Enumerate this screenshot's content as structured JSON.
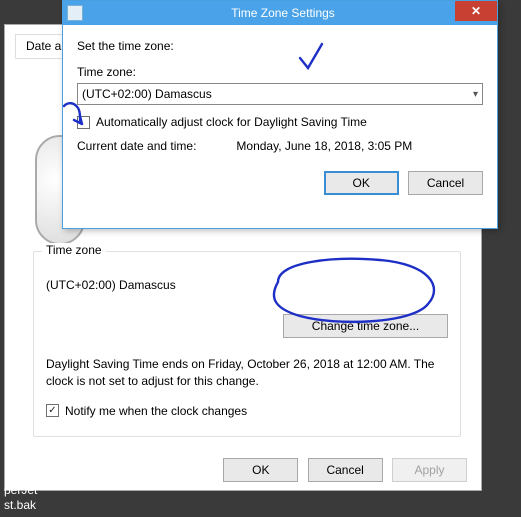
{
  "background": {
    "tab_label": "Date a",
    "fieldset": {
      "legend": "Time zone",
      "value": "(UTC+02:00) Damascus",
      "change_button": "Change time zone...",
      "dst_text": "Daylight Saving Time ends on Friday, October 26, 2018 at 12:00 AM. The clock is not set to adjust for this change.",
      "notify_label": "Notify me when the clock changes"
    },
    "buttons": {
      "ok": "OK",
      "cancel": "Cancel",
      "apply": "Apply"
    }
  },
  "front": {
    "title": "Time Zone Settings",
    "prompt": "Set the time zone:",
    "tz_label": "Time zone:",
    "tz_selected": "(UTC+02:00) Damascus",
    "auto_dst_label": "Automatically adjust clock for Daylight Saving Time",
    "current_label": "Current date and time:",
    "current_value": "Monday, June 18, 2018, 3:05 PM",
    "buttons": {
      "ok": "OK",
      "cancel": "Cancel"
    }
  },
  "stray": {
    "line1": "perJet",
    "line2": "st.bak"
  },
  "colors": {
    "titlebar": "#4aa3e8",
    "close": "#c84031",
    "annotation": "#1d2fc6",
    "border": "#4a9fe0"
  }
}
